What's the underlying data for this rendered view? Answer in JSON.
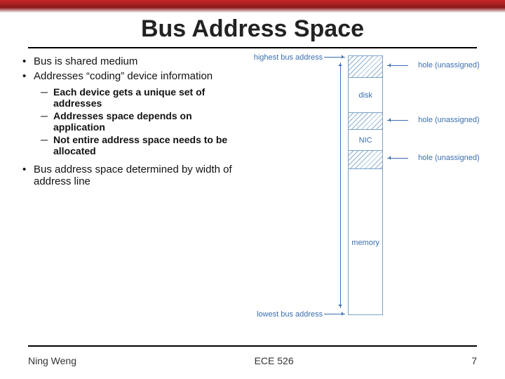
{
  "title": "Bus Address Space",
  "bullets": {
    "b1": "Bus is shared medium",
    "b2": "Addresses “coding” device information",
    "b2a": "Each device gets a unique set of addresses",
    "b2b": "Addresses space depends on application",
    "b2c": "Not entire address space needs to be allocated",
    "b3": "Bus address space determined by width of address line"
  },
  "diagram": {
    "top_label": "highest bus address",
    "bottom_label": "lowest bus address",
    "hole_label": "hole (unassigned)",
    "seg_disk": "disk",
    "seg_nic": "NIC",
    "seg_memory": "memory"
  },
  "footer": {
    "left": "Ning Weng",
    "center": "ECE 526",
    "right": "7"
  }
}
